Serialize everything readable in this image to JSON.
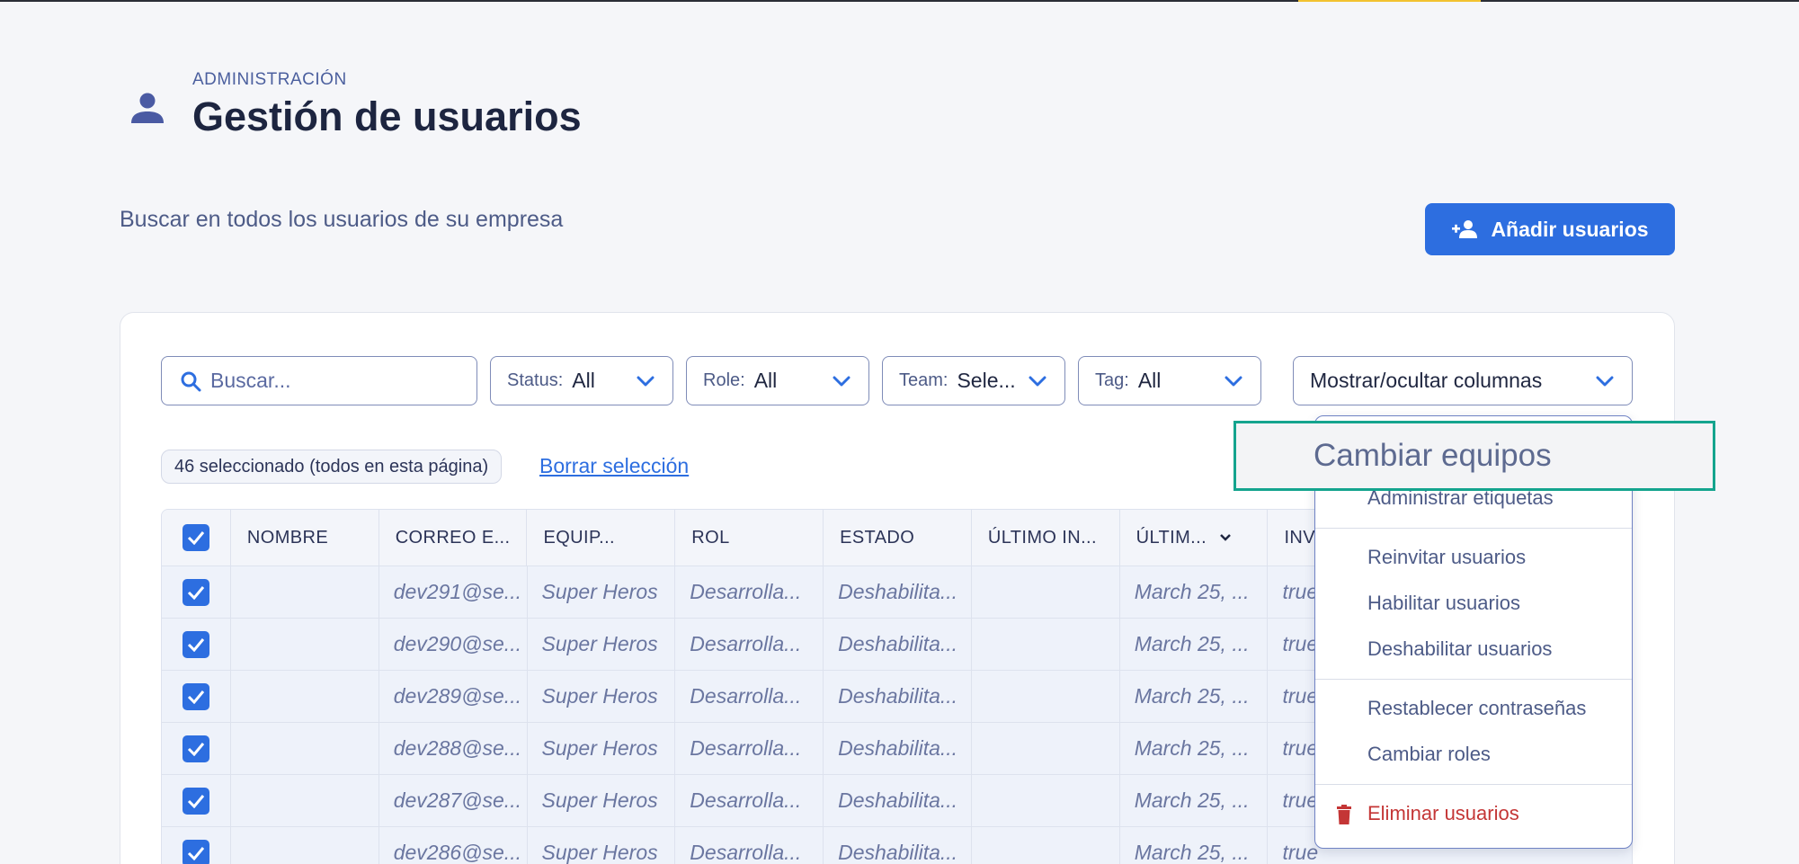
{
  "header": {
    "overline": "ADMINISTRACIÓN",
    "title": "Gestión de usuarios",
    "icon": "person-icon"
  },
  "subtitle": "Buscar en todos los usuarios de su empresa",
  "add_button": {
    "label": "Añadir usuarios",
    "icon": "person-add-icon"
  },
  "search": {
    "placeholder": "Buscar..."
  },
  "filters": [
    {
      "label": "Status:",
      "value": "All"
    },
    {
      "label": "Role:",
      "value": "All"
    },
    {
      "label": "Team:",
      "value": "Sele..."
    },
    {
      "label": "Tag:",
      "value": "All"
    }
  ],
  "columns_toggle": "Mostrar/ocultar columnas",
  "selection": {
    "chip": "46 seleccionado (todos en esta página)",
    "clear": "Borrar selección"
  },
  "table": {
    "headers": [
      "NOMBRE",
      "CORREO E...",
      "EQUIP...",
      "ROL",
      "ESTADO",
      "ÚLTIMO IN...",
      "ÚLTIM...",
      "INV"
    ],
    "rows": [
      {
        "name": "",
        "email": "dev291@se...",
        "team": "Super Heros",
        "role": "Desarrolla...",
        "status": "Deshabilita...",
        "last_login": "",
        "last": "March 25, ...",
        "inv": "true"
      },
      {
        "name": "",
        "email": "dev290@se...",
        "team": "Super Heros",
        "role": "Desarrolla...",
        "status": "Deshabilita...",
        "last_login": "",
        "last": "March 25, ...",
        "inv": "true"
      },
      {
        "name": "",
        "email": "dev289@se...",
        "team": "Super Heros",
        "role": "Desarrolla...",
        "status": "Deshabilita...",
        "last_login": "",
        "last": "March 25, ...",
        "inv": "true"
      },
      {
        "name": "",
        "email": "dev288@se...",
        "team": "Super Heros",
        "role": "Desarrolla...",
        "status": "Deshabilita...",
        "last_login": "",
        "last": "March 25, ...",
        "inv": "true"
      },
      {
        "name": "",
        "email": "dev287@se...",
        "team": "Super Heros",
        "role": "Desarrolla...",
        "status": "Deshabilita...",
        "last_login": "",
        "last": "March 25, ...",
        "inv": "true"
      },
      {
        "name": "",
        "email": "dev286@se...",
        "team": "Super Heros",
        "role": "Desarrolla...",
        "status": "Deshabilita...",
        "last_login": "",
        "last": "March 25, ...",
        "inv": "true"
      }
    ]
  },
  "menu": {
    "highlighted": "Cambiar equipos",
    "items": [
      "Administrar etiquetas",
      "Reinvitar usuarios",
      "Habilitar usuarios",
      "Deshabilitar usuarios",
      "Restablecer contraseñas",
      "Cambiar roles"
    ],
    "danger": "Eliminar usuarios"
  },
  "colors": {
    "primary": "#2d6ee0",
    "danger": "#c43636",
    "highlight_border": "#14a48e"
  }
}
